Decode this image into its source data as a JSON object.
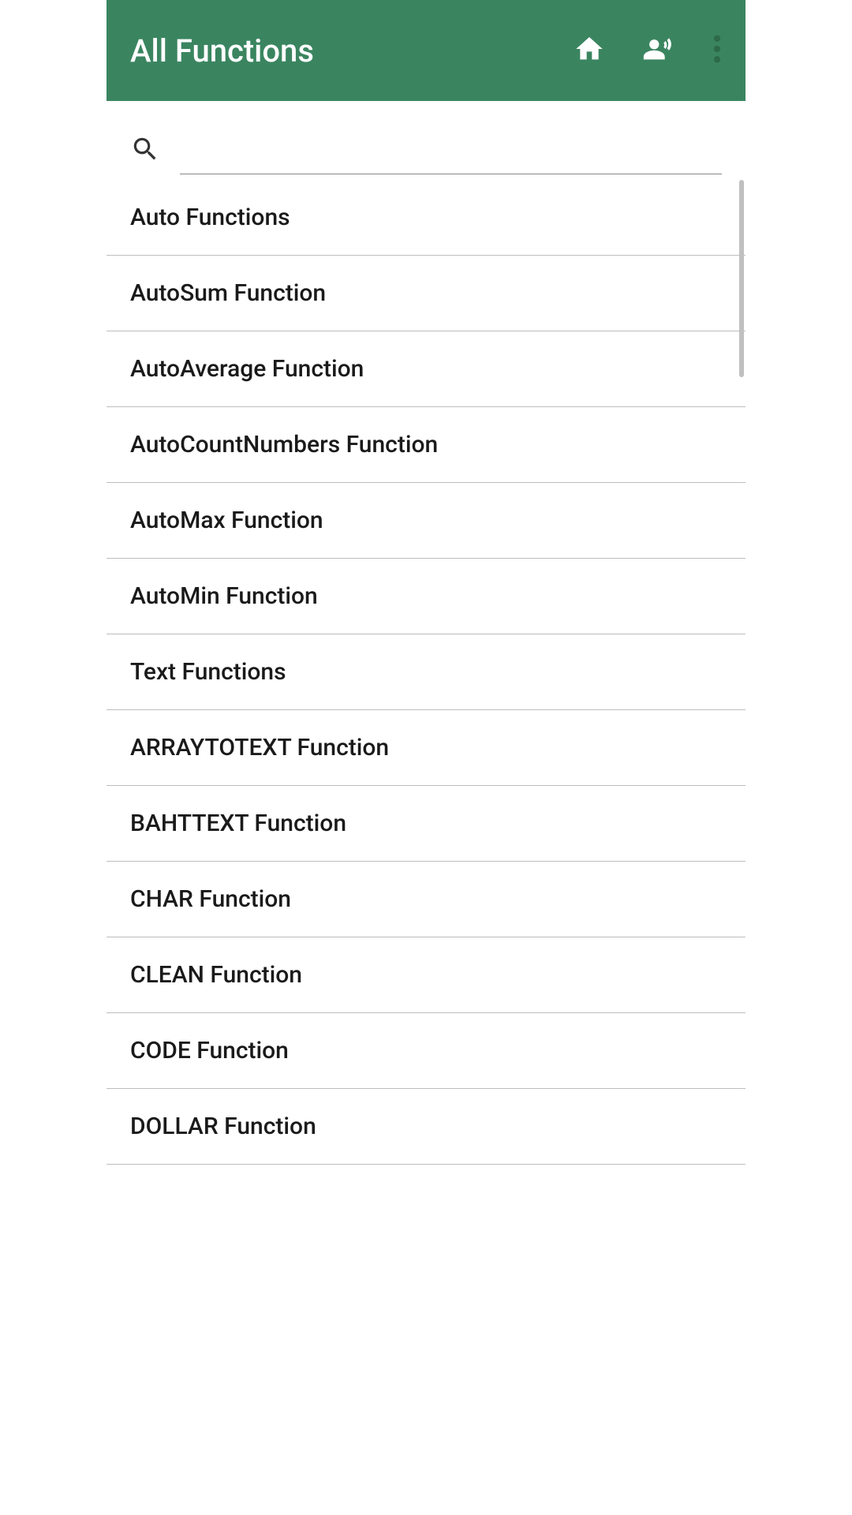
{
  "header": {
    "title": "All Functions"
  },
  "search": {
    "value": ""
  },
  "functions": [
    "Auto Functions",
    "AutoSum Function",
    "AutoAverage Function",
    "AutoCountNumbers Function",
    "AutoMax Function",
    "AutoMin Function",
    "Text Functions",
    "ARRAYTOTEXT Function",
    "BAHTTEXT Function",
    "CHAR Function",
    "CLEAN Function",
    "CODE Function",
    "DOLLAR Function"
  ]
}
